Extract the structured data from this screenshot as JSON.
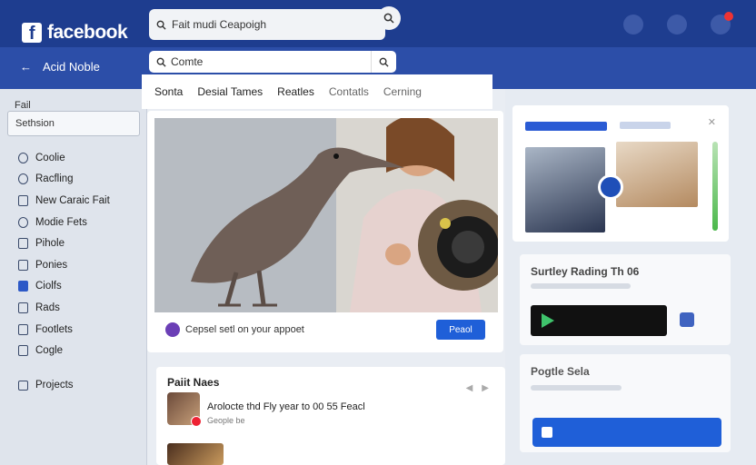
{
  "header": {
    "brand": "facebook",
    "brand_letter": "f",
    "search_text": "Fait mudi Ceapoigh",
    "icons": [
      "search-icon",
      "notifications-icon",
      "settings-icon",
      "alerts-icon"
    ]
  },
  "subbar": {
    "back_label": "Acid Noble",
    "search_text": "Comte"
  },
  "sidebar": {
    "heading": "Fail",
    "input_value": "Sethsion",
    "items": [
      {
        "label": "Coolie",
        "icon": "circle-icon"
      },
      {
        "label": "Racfling",
        "icon": "circle-icon"
      },
      {
        "label": "New Caraic Fait",
        "icon": "box-icon"
      },
      {
        "label": "Modie Fets",
        "icon": "circle-icon"
      },
      {
        "label": "Pihole",
        "icon": "page-icon"
      },
      {
        "label": "Ponies",
        "icon": "page-icon"
      },
      {
        "label": "Ciolfs",
        "icon": "square-fill-icon"
      },
      {
        "label": "Rads",
        "icon": "page-icon"
      },
      {
        "label": "Footlets",
        "icon": "page-icon"
      },
      {
        "label": "Cogle",
        "icon": "page-icon"
      }
    ],
    "projects_label": "Projects"
  },
  "tabs": [
    {
      "label": "Sonta",
      "active": true
    },
    {
      "label": "Desial Tames",
      "active": false
    },
    {
      "label": "Reatles",
      "active": false
    },
    {
      "label": "Contatls",
      "active": false
    },
    {
      "label": "Cerning",
      "active": false
    }
  ],
  "post": {
    "footer_text": "Cepsel setl on your appoet",
    "button_label": "Peaol"
  },
  "card2": {
    "title": "Paiit Naes",
    "row_title": "Arolocte thd Fly year to 00 55 Feacl",
    "row_sub": "Geople be"
  },
  "right": {
    "card2_title": "Surtley Rading Th 06",
    "card3_title": "Pogtle Sela"
  }
}
